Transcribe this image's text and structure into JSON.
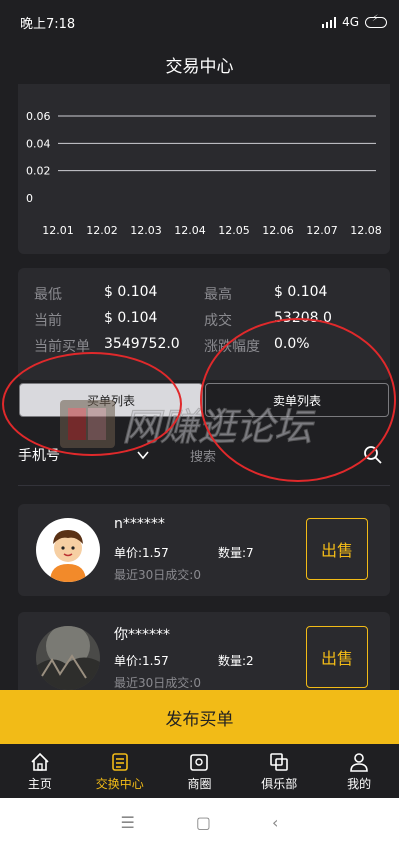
{
  "status": {
    "time": "晚上7:18",
    "network": "4G"
  },
  "header": {
    "title": "交易中心"
  },
  "chart_data": {
    "type": "line",
    "categories": [
      "12.01",
      "12.02",
      "12.03",
      "12.04",
      "12.05",
      "12.06",
      "12.07",
      "12.08"
    ],
    "y_ticks": [
      "0",
      "0.02",
      "0.04",
      "0.06"
    ],
    "ylim": [
      0,
      0.06
    ],
    "grid": true
  },
  "stats": {
    "low_label": "最低",
    "low_value": "$ 0.104",
    "high_label": "最高",
    "high_value": "$ 0.104",
    "current_label": "当前",
    "current_value": "$ 0.104",
    "deal_label": "成交",
    "deal_value": "53208.0",
    "buy_label": "当前买单",
    "buy_value": "3549752.0",
    "change_label": "涨跌幅度",
    "change_value": "0.0%"
  },
  "tabs": {
    "buy_list": "买单列表",
    "sell_list": "卖单列表"
  },
  "filter": {
    "selected": "手机号",
    "search_placeholder": "搜索"
  },
  "watermark": {
    "text": "网赚逛论坛"
  },
  "orders": [
    {
      "name": "n******",
      "price": "单价:1.57",
      "qty": "数量:7",
      "recent": "最近30日成交:0",
      "action": "出售"
    },
    {
      "name": "你******",
      "price": "单价:1.57",
      "qty": "数量:2",
      "recent": "最近30日成交:0",
      "action": "出售"
    }
  ],
  "publish": {
    "label": "发布买单"
  },
  "nav": [
    {
      "label": "主页",
      "icon": "home-icon"
    },
    {
      "label": "交换中心",
      "icon": "exchange-icon"
    },
    {
      "label": "商圈",
      "icon": "shop-icon"
    },
    {
      "label": "俱乐部",
      "icon": "club-icon"
    },
    {
      "label": "我的",
      "icon": "user-icon"
    }
  ],
  "colors": {
    "accent": "#f2bb17",
    "background": "#1f1f22",
    "card": "#2a2a2e",
    "annotation": "#e0292b"
  }
}
